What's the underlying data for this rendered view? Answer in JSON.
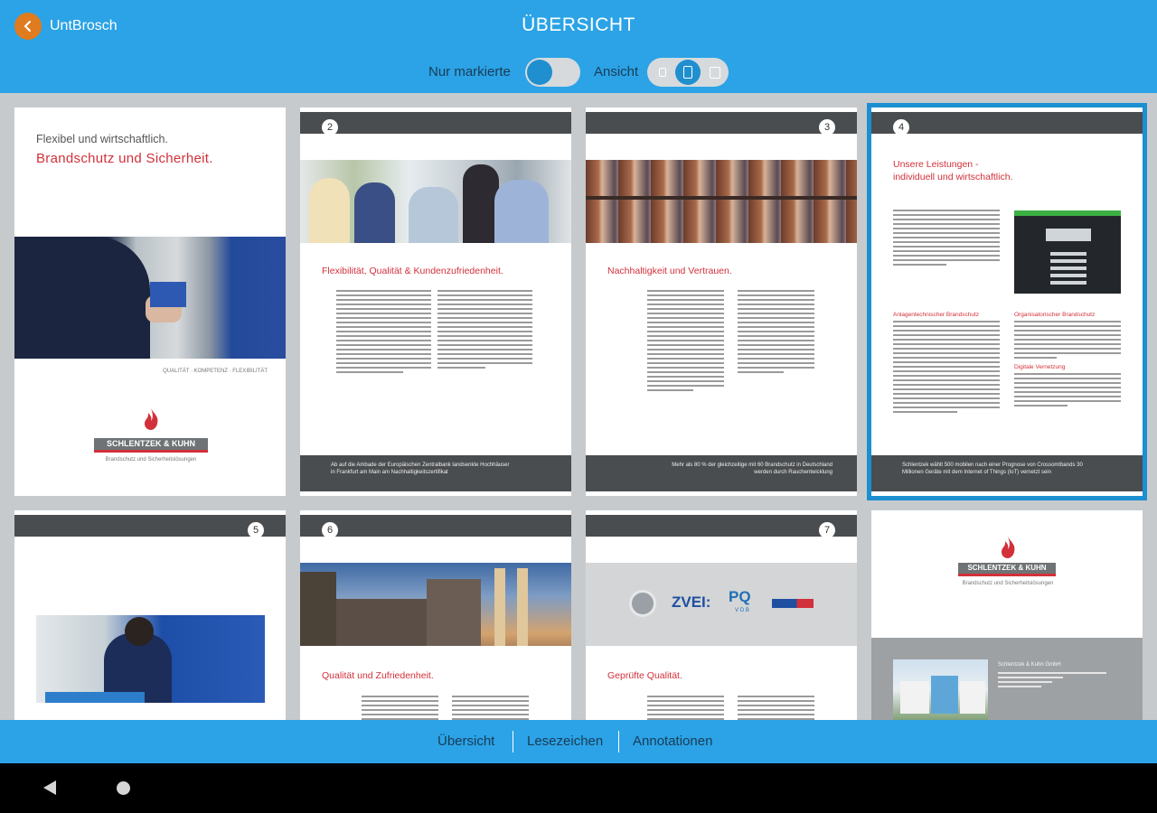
{
  "header": {
    "back_label": "UntBrosch",
    "title": "ÜBERSICHT",
    "only_marked_label": "Nur markierte",
    "view_label": "Ansicht"
  },
  "pages": [
    {
      "num": "",
      "line1": "Flexibel und wirtschaftlich.",
      "line2": "Brandschutz und Sicherheit.",
      "tagline": "QUALITÄT · KOMPETENZ · FLEXIBILITÄT",
      "logo": "SCHLENTZEK & KUHN",
      "logo_sub": "Brandschutz und Sicherheitslösungen"
    },
    {
      "num": "2",
      "heading": "Flexibilität, Qualität & Kundenzufriedenheit.",
      "footer": "Ab auf die Ambade der Europäischen Zentralbank landsenkte Hochhäuser in Frankfurt am Main am Nachhaltigkeitszertifikat"
    },
    {
      "num": "3",
      "heading": "Nachhaltigkeit und Vertrauen.",
      "footer": "Mehr als 80 % der gleichzeitige mit 60 Brandschutz in Deutschland werden durch Rauchentwicklung"
    },
    {
      "num": "4",
      "heading": "Unsere Leistungen -\nindividuell und wirtschaftlich.",
      "sub1": "Anlagentechnischer Brandschutz",
      "sub2": "Organisatorischer Brandschutz",
      "sub3": "Digitale Vernetzung",
      "footer": "Schlentzek wählt 500 mobilen nach einer Prognose von Crossomtbands 30 Millionen Geräte mit dem Internet of Things (IoT) vernetzt sein"
    },
    {
      "num": "5"
    },
    {
      "num": "6",
      "heading": "Qualität und Zufriedenheit."
    },
    {
      "num": "7",
      "heading": "Geprüfte Qualität.",
      "logo_a": "ZVEI:",
      "logo_b": "PQ",
      "logo_b_sub": "V D B"
    },
    {
      "num": "",
      "logo": "SCHLENTZEK & KUHN",
      "logo_sub": "Brandschutz und Sicherheitslösungen",
      "contact": "Schlentzek & Kuhn GmbH"
    }
  ],
  "tabs": {
    "overview": "Übersicht",
    "bookmarks": "Lesezeichen",
    "annotations": "Annotationen"
  },
  "colors": {
    "brand_blue": "#2ba3e6",
    "accent_orange": "#e07b1f",
    "accent_red": "#d2303a",
    "selection_blue": "#1b8fd0"
  }
}
